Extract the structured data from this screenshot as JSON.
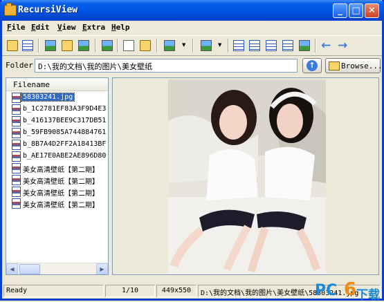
{
  "window": {
    "title": "RecursiView"
  },
  "menu": [
    {
      "first": "F",
      "rest": "ile"
    },
    {
      "first": "E",
      "rest": "dit"
    },
    {
      "first": "V",
      "rest": "iew"
    },
    {
      "first": "E",
      "rest": "xtra"
    },
    {
      "first": "H",
      "rest": "elp"
    }
  ],
  "folder": {
    "label": "Folder",
    "path": "D:\\我的文档\\我的图片\\美女壁纸",
    "browse_label": "Browse..."
  },
  "file_list": {
    "column_header": "Filename",
    "files": [
      "58303241.jpg",
      "b_1C2781EF83A3F9D4E3",
      "b_416137BEE9C317DB51",
      "b_59FB9085A744884761",
      "b_8B7A4D2FF2A18413BF",
      "b_AE17E0ABE2AE896D80",
      "美女高清壁纸【第二期】",
      "美女高清壁纸【第二期】",
      "美女高清壁纸【第二期】",
      "美女高清壁纸【第二期】"
    ],
    "selected_index": 0
  },
  "status": {
    "state": "Ready",
    "position": "1/10",
    "dimensions": "449x550",
    "path": "D:\\我的文档\\我的图片\\美女壁纸\\58303241.jpg"
  },
  "watermark": {
    "pc": "PC",
    "six": "6",
    "cn": "下载"
  },
  "icons": {
    "toolbar": [
      "tree-icon",
      "refresh-icon",
      "view-icon",
      "open-icon",
      "slideshow-icon",
      "fullscreen-icon",
      "copy-icon",
      "paste-icon",
      "settings-icon",
      "export-icon",
      "thumbnail-view-icon",
      "list-view-icon",
      "details-view-icon",
      "small-icons-icon",
      "large-icons-icon",
      "back-arrow-icon",
      "forward-arrow-icon"
    ]
  },
  "colors": {
    "title_bar": "#0055e5",
    "selection": "#316ac5",
    "window_bg": "#ece9d8"
  }
}
